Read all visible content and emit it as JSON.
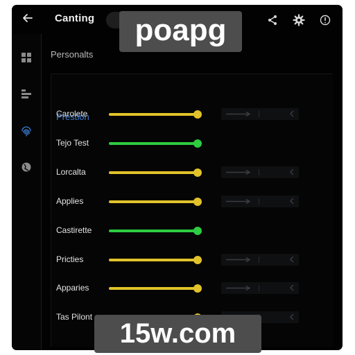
{
  "header": {
    "title": "Canting",
    "back_icon": "arrow-left-icon",
    "actions": [
      "share-icon",
      "gear-icon",
      "info-icon"
    ]
  },
  "sidebar": {
    "items": [
      "grid-icon",
      "list-icon",
      "fingerprint-icon",
      "globe-icon"
    ],
    "active": "fingerprint-icon"
  },
  "main": {
    "section_title": "Personalts",
    "panel_heading": "Prestion",
    "rows": [
      {
        "label": "Carolete",
        "level": 1.0,
        "color": "#e2c22a",
        "has_control": true
      },
      {
        "label": "Tejo Test",
        "level": 1.0,
        "color": "#2ecc40",
        "has_control": false
      },
      {
        "label": "Lorcalta",
        "level": 1.0,
        "color": "#e2c22a",
        "has_control": true
      },
      {
        "label": "Applies",
        "level": 1.0,
        "color": "#e2c22a",
        "has_control": true
      },
      {
        "label": "Castirette",
        "level": 1.0,
        "color": "#2ecc40",
        "has_control": false
      },
      {
        "label": "Pricties",
        "level": 1.0,
        "color": "#e2c22a",
        "has_control": true
      },
      {
        "label": "Apparies",
        "level": 1.0,
        "color": "#e2c22a",
        "has_control": true
      },
      {
        "label": "Tas Pilont",
        "level": 1.0,
        "color": "#e2c22a",
        "has_control": true
      }
    ]
  },
  "watermark": {
    "top": "poapg",
    "bottom": "15w.com"
  },
  "colors": {
    "background": "#020202",
    "heading_blue": "#3e7fd6",
    "slider_yellow": "#e2c22a",
    "slider_green": "#2ecc40",
    "watermark_bg": "#4d4d4d"
  }
}
